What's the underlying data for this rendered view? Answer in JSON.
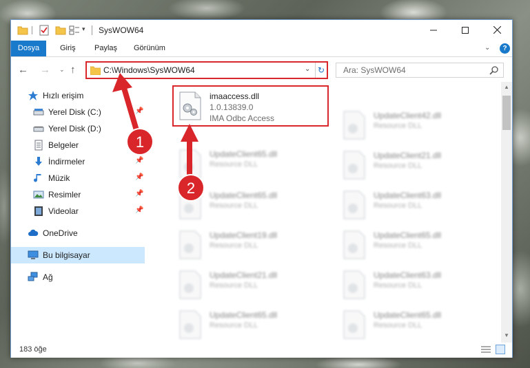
{
  "window": {
    "title": "SysWOW64",
    "controls": {
      "minimize": "—",
      "maximize": "☐",
      "close": "✕"
    }
  },
  "ribbon": {
    "tabs": [
      "Dosya",
      "Giriş",
      "Paylaş",
      "Görünüm"
    ],
    "expand": "⌄",
    "help": "?"
  },
  "navigation": {
    "back": "←",
    "forward": "→",
    "recent": "⌄",
    "up": "↑",
    "address": "C:\\Windows\\SysWOW64",
    "address_dropdown": "⌄",
    "refresh": "↻",
    "search_placeholder": "Ara: SysWOW64"
  },
  "sidebar": {
    "items": [
      {
        "label": "Hızlı erişim",
        "icon": "star-icon",
        "pinned": false
      },
      {
        "label": "Yerel Disk (C:)",
        "icon": "drive-icon",
        "pinned": true,
        "pin": "📌"
      },
      {
        "label": "Yerel Disk (D:)",
        "icon": "drive-icon",
        "pinned": false
      },
      {
        "label": "Belgeler",
        "icon": "documents-icon",
        "pinned": false
      },
      {
        "label": "İndirmeler",
        "icon": "download-icon",
        "pinned": true,
        "pin": "📌"
      },
      {
        "label": "Müzik",
        "icon": "music-icon",
        "pinned": true,
        "pin": "📌"
      },
      {
        "label": "Resimler",
        "icon": "pictures-icon",
        "pinned": true,
        "pin": "📌"
      },
      {
        "label": "Videolar",
        "icon": "videos-icon",
        "pinned": true,
        "pin": "📌"
      },
      {
        "label": "OneDrive",
        "icon": "cloud-icon",
        "pinned": false
      },
      {
        "label": "Bu bilgisayar",
        "icon": "computer-icon",
        "pinned": false,
        "selected": true
      },
      {
        "label": "Ağ",
        "icon": "network-icon",
        "pinned": false
      }
    ]
  },
  "files": {
    "highlighted": {
      "name": "imaaccess.dll",
      "version": "1.0.13839.0",
      "description": "IMA Odbc Access"
    },
    "left_column": [
      {
        "name": "UpdateClient65.dll",
        "type": "Resource DLL"
      },
      {
        "name": "UpdateClient65.dll",
        "type": "Resource DLL"
      },
      {
        "name": "UpdateClient19.dll",
        "type": "Resource DLL"
      },
      {
        "name": "UpdateClient21.dll",
        "type": "Resource DLL"
      },
      {
        "name": "UpdateClient65.dll",
        "type": "Resource DLL"
      }
    ],
    "right_column": [
      {
        "name": "UpdateClient42.dll",
        "type": "Resource DLL"
      },
      {
        "name": "UpdateClient21.dll",
        "type": "Resource DLL"
      },
      {
        "name": "UpdateClient63.dll",
        "type": "Resource DLL"
      },
      {
        "name": "UpdateClient65.dll",
        "type": "Resource DLL"
      },
      {
        "name": "UpdateClient63.dll",
        "type": "Resource DLL"
      },
      {
        "name": "UpdateClient65.dll",
        "type": "Resource DLL"
      }
    ]
  },
  "status": {
    "item_count": "183 öğe"
  },
  "annotations": {
    "marker1": "1",
    "marker2": "2",
    "color": "#d9262b"
  }
}
